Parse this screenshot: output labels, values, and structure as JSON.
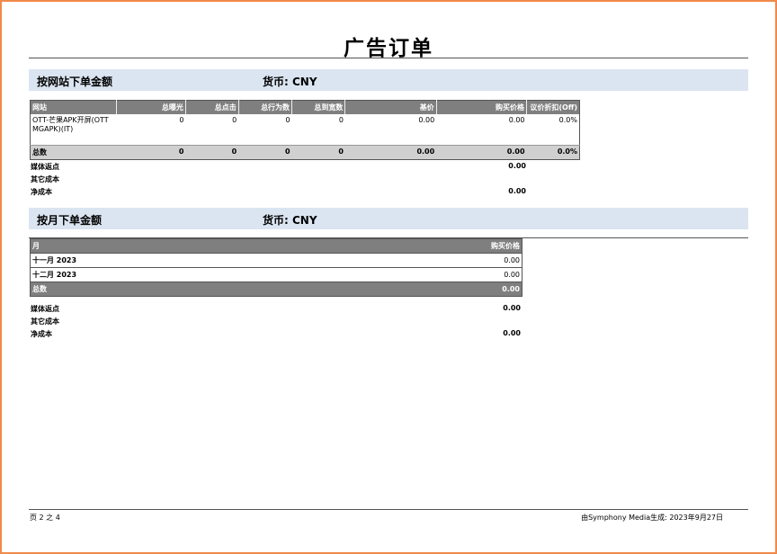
{
  "title": "广告订单",
  "section1": {
    "label": "按网站下单金额",
    "currency": "货币: CNY",
    "columns": [
      "网站",
      "总曝光",
      "总点击",
      "总行为数",
      "总到宽数",
      "基价",
      "购买价格",
      "议价折扣(Off)"
    ],
    "rows": [
      [
        "OTT-芒果APK开屏(OTTMGAPK)(IT)",
        "0",
        "0",
        "0",
        "0",
        "0.00",
        "0.00",
        "0.0%"
      ]
    ],
    "total": [
      "总数",
      "0",
      "0",
      "0",
      "0",
      "0.00",
      "0.00",
      "0.0%"
    ],
    "summary": [
      {
        "label": "媒体返点",
        "value": "0.00"
      },
      {
        "label": "其它成本",
        "value": ""
      },
      {
        "label": "净成本",
        "value": "0.00"
      }
    ]
  },
  "section2": {
    "label": "按月下单金额",
    "currency": "货币: CNY",
    "columns": [
      "月",
      "购买价格"
    ],
    "rows": [
      [
        "十一月 2023",
        "0.00"
      ],
      [
        "十二月 2023",
        "0.00"
      ]
    ],
    "total": [
      "总数",
      "0.00"
    ],
    "summary": [
      {
        "label": "媒体返点",
        "value": "0.00"
      },
      {
        "label": "其它成本",
        "value": ""
      },
      {
        "label": "净成本",
        "value": "0.00"
      }
    ]
  },
  "footer": {
    "page": "页 2 之 4",
    "generated": "由Symphony Media生成: 2023年9月27日"
  }
}
